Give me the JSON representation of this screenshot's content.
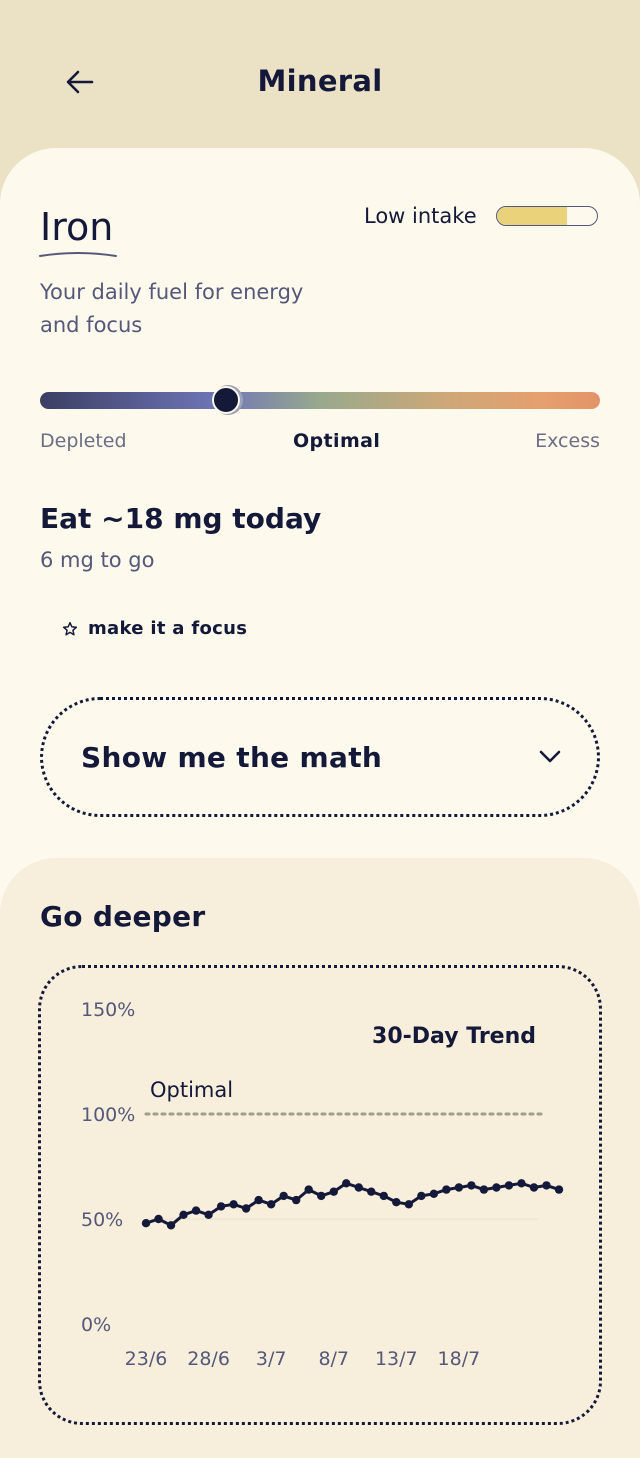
{
  "header": {
    "title": "Mineral",
    "back_icon": "arrow-left-icon"
  },
  "nutrient": {
    "name": "Iron",
    "tagline": "Your daily fuel for energy and focus",
    "intake_status": "Low intake",
    "intake_level": 0.7,
    "scale": {
      "labels": [
        "Depleted",
        "Optimal",
        "Excess"
      ],
      "position": 0.33
    },
    "target": "Eat ~18 mg today",
    "remaining": "6 mg to go",
    "focus_label": "make it a focus",
    "focus_icon": "star-outline-icon"
  },
  "math_toggle": {
    "label": "Show me the math",
    "icon": "chevron-down-icon"
  },
  "deeper": {
    "title": "Go deeper"
  },
  "colors": {
    "background": "#ebe1c5",
    "card": "#fdf9ec",
    "deeper_card": "#f7eedc",
    "ink": "#14193a",
    "intake_fill": "#ead27a",
    "optimal_line": "#9aa084"
  },
  "chart_data": {
    "type": "line",
    "title": "30-Day Trend",
    "y_ticks": [
      "150%",
      "100%",
      "50%",
      "0%"
    ],
    "ylim": [
      0,
      150
    ],
    "x_tick_labels": [
      "23/6",
      "28/6",
      "3/7",
      "8/7",
      "13/7",
      "18/7"
    ],
    "reference_line": {
      "label": "Optimal",
      "value": 100
    },
    "series": [
      {
        "values": [
          48,
          50,
          47,
          52,
          54,
          52,
          56,
          57,
          55,
          59,
          57,
          61,
          59,
          64,
          61,
          63,
          67,
          65,
          63,
          61,
          58,
          57,
          61,
          62,
          64,
          65,
          66,
          64,
          65,
          66,
          67,
          65,
          66,
          64
        ]
      }
    ]
  }
}
